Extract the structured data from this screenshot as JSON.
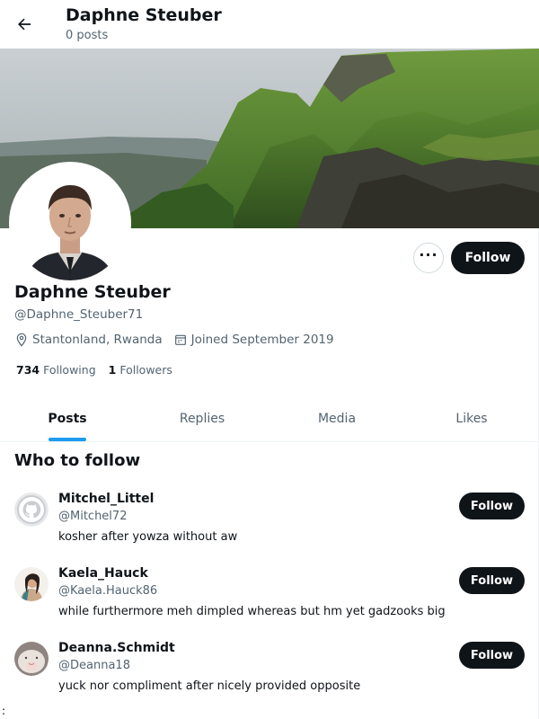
{
  "header": {
    "title": "Daphne Steuber",
    "subtitle": "0 posts"
  },
  "profile": {
    "name": "Daphne Steuber",
    "handle": "@Daphne_Steuber71",
    "location": "Stantonland, Rwanda",
    "joined": "Joined September 2019",
    "following_count": "734",
    "following_label": "Following",
    "followers_count": "1",
    "followers_label": "Followers",
    "follow_label": "Follow",
    "more_label": "···"
  },
  "tabs": [
    {
      "label": "Posts",
      "active": true
    },
    {
      "label": "Replies",
      "active": false
    },
    {
      "label": "Media",
      "active": false
    },
    {
      "label": "Likes",
      "active": false
    }
  ],
  "who_to_follow": {
    "title": "Who to follow",
    "suggestions": [
      {
        "name": "Mitchel_Littel",
        "handle": "@Mitchel72",
        "bio": "kosher after yowza without aw",
        "follow_label": "Follow",
        "avatar": "github-default-avatar"
      },
      {
        "name": "Kaela_Hauck",
        "handle": "@Kaela.Hauck86",
        "bio": "while furthermore meh dimpled whereas but hm yet gadzooks big",
        "follow_label": "Follow",
        "avatar": "person-photo-avatar"
      },
      {
        "name": "Deanna.Schmidt",
        "handle": "@Deanna18",
        "bio": "yuck nor compliment after nicely provided opposite",
        "follow_label": "Follow",
        "avatar": "animal-photo-avatar"
      }
    ]
  },
  "stray_text": ":",
  "colors": {
    "accent": "#1d9bf0",
    "text": "#0f1419",
    "muted": "#536471",
    "button": "#0f1419"
  }
}
